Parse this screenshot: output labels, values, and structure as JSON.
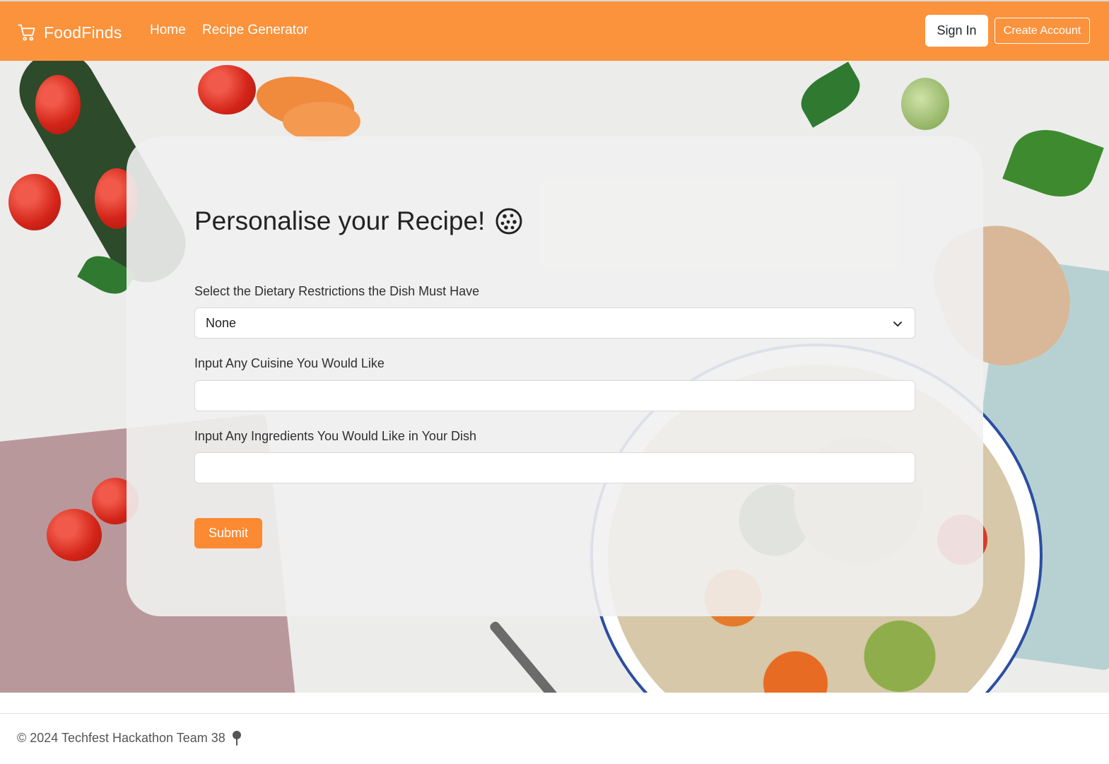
{
  "navbar": {
    "brand": "FoodFinds",
    "brand_icon": "cart-icon",
    "links": [
      "Home",
      "Recipe Generator"
    ],
    "sign_in": "Sign In",
    "create_account": "Create Account",
    "color": "#fb923c"
  },
  "form": {
    "title": "Personalise your Recipe!",
    "title_icon": "cookie-icon",
    "dietary_label": "Select the Dietary Restrictions the Dish Must Have",
    "dietary_value": "None",
    "cuisine_label": "Input Any Cuisine You Would Like",
    "cuisine_value": "",
    "ingredients_label": "Input Any Ingredients You Would Like in Your Dish",
    "ingredients_value": "",
    "submit": "Submit"
  },
  "footer": {
    "text": "© 2024 Techfest Hackathon Team 38",
    "icon": "pin-icon"
  }
}
